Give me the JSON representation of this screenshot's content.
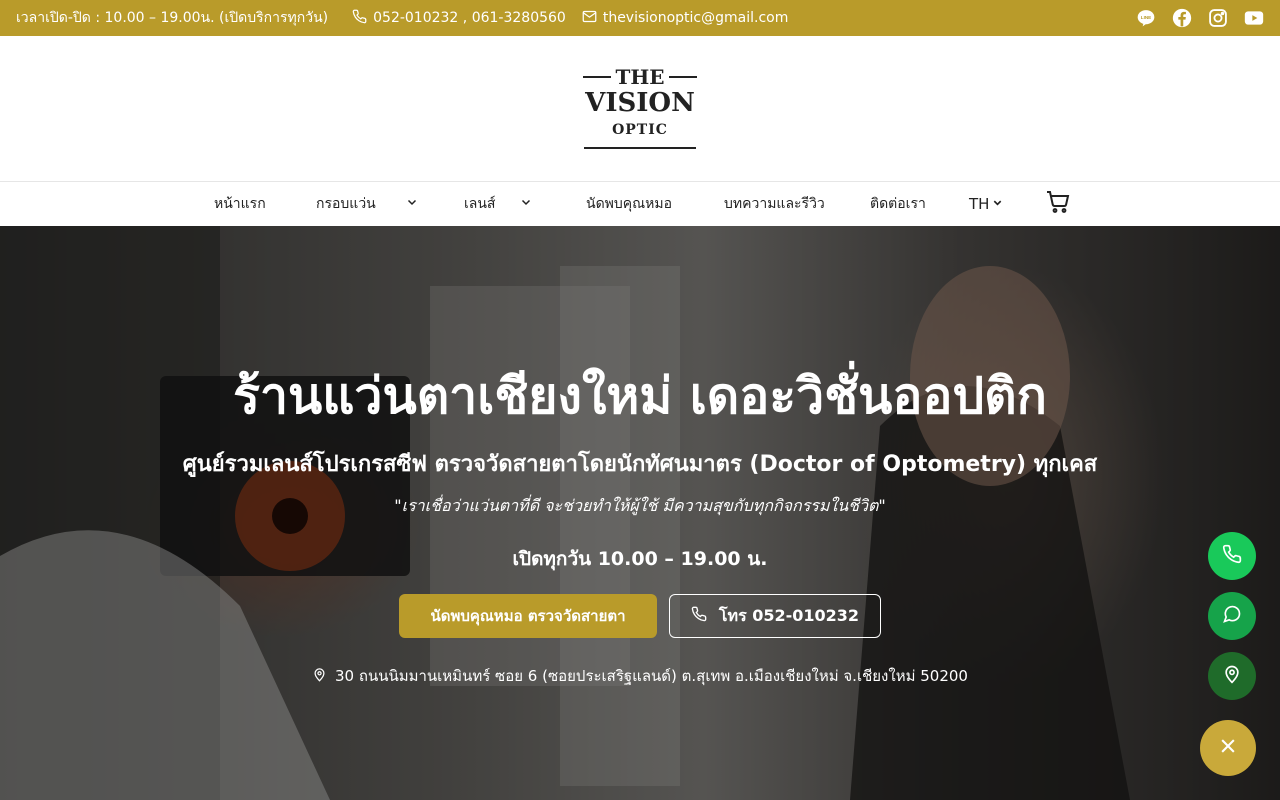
{
  "topbar": {
    "hours": "เวลาเปิด-ปิด : 10.00 – 19.00น. (เปิดบริการทุกวัน)",
    "phones": "052-010232 , 061-3280560",
    "email": "thevisionoptic@gmail.com",
    "socials": [
      "line-icon",
      "facebook-icon",
      "instagram-icon",
      "youtube-icon"
    ]
  },
  "logo": {
    "the": "THE",
    "vision": "VISION",
    "optic": "OPTIC"
  },
  "nav": {
    "home": "หน้าแรก",
    "frames": "กรอบแว่น",
    "lenses": "เลนส์",
    "appointment": "นัดพบคุณหมอ",
    "articles": "บทความและรีวิว",
    "contact": "ติดต่อเรา",
    "lang": "TH"
  },
  "hero": {
    "title": "ร้านแว่นตาเชียงใหม่ เดอะวิชั่นออปติก",
    "subtitle": "ศูนย์รวมเลนส์โปรเกรสซีฟ ตรวจวัดสายตาโดยนักทัศนมาตร (Doctor of Optometry) ทุกเคส",
    "quote": "\"เราเชื่อว่าแว่นตาที่ดี จะช่วยทำให้ผู้ใช้ มีความสุขกับทุกกิจกรรมในชีวิต\"",
    "open": "เปิดทุกวัน 10.00 – 19.00 น.",
    "btn_appointment": "นัดพบคุณหมอ ตรวจวัดสายตา",
    "btn_call": "โทร 052-010232",
    "address": "30 ถนนนิมมานเหมินทร์ ซอย 6 (ซอยประเสริฐแลนด์) ต.สุเทพ อ.เมืองเชียงใหม่ จ.เชียงใหม่ 50200"
  },
  "colors": {
    "brand": "#b99b2a",
    "fab_phone": "#19c95a",
    "fab_chat": "#16a34a",
    "fab_map": "#1f6b2a",
    "fab_close": "#c9a93a"
  }
}
